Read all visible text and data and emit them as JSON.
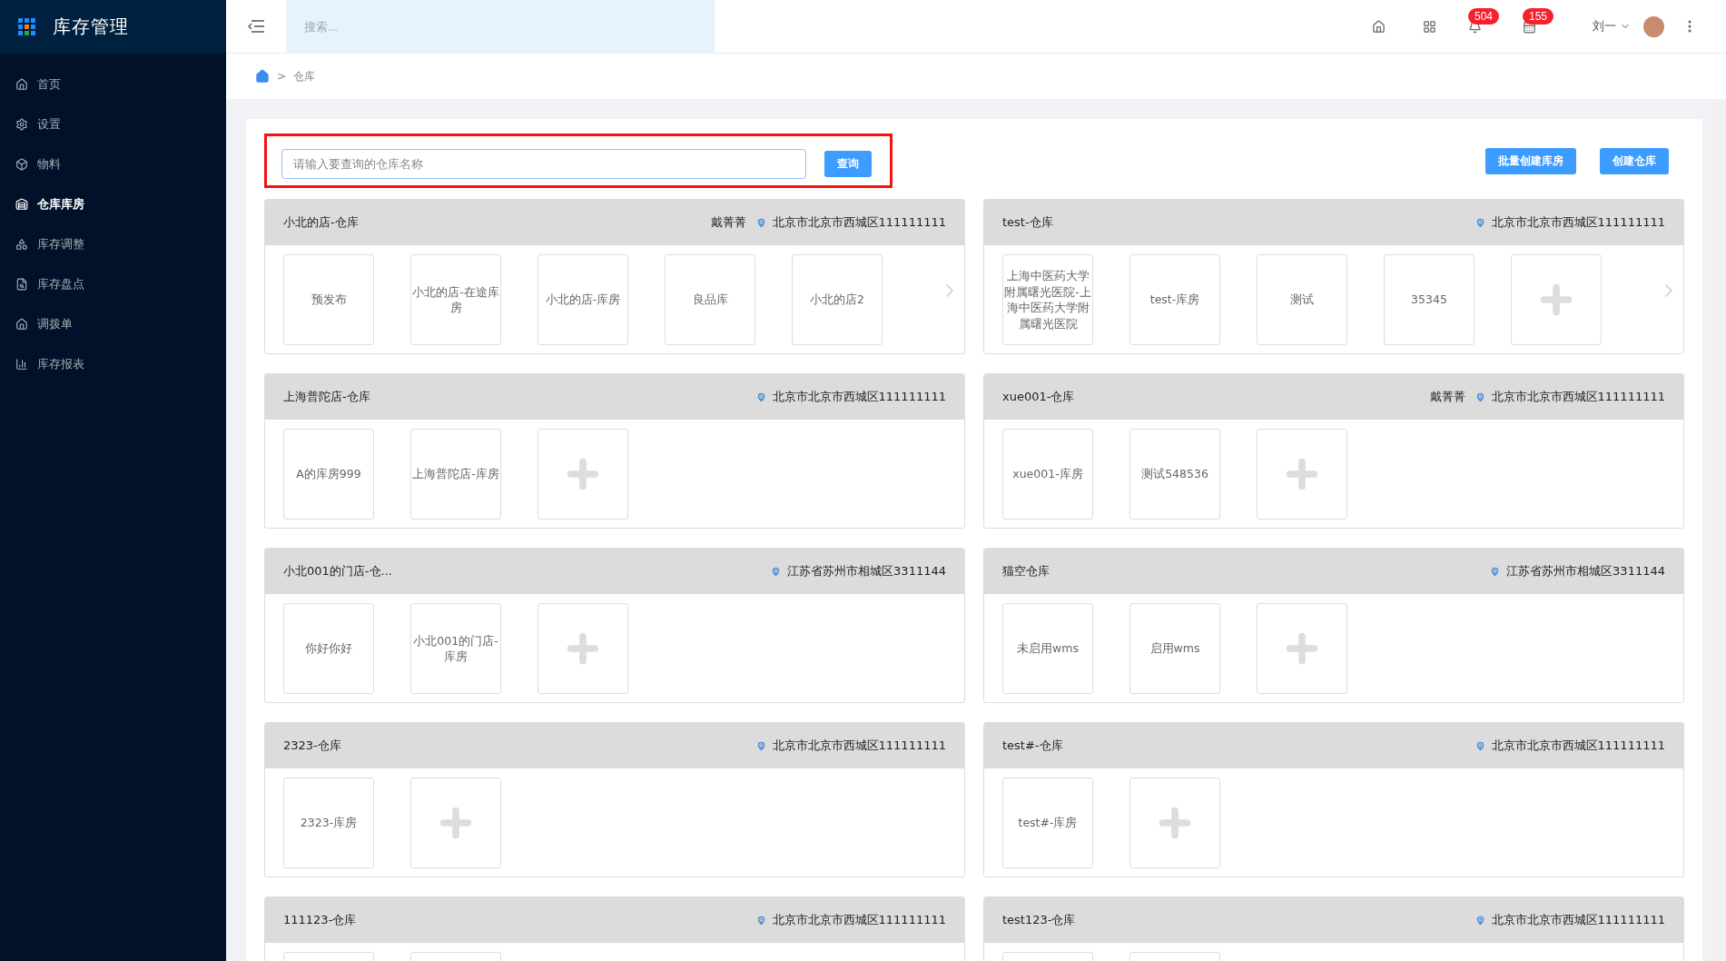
{
  "app": {
    "title": "库存管理"
  },
  "sidebar": {
    "items": [
      {
        "label": "首页",
        "selected": false
      },
      {
        "label": "设置",
        "selected": false
      },
      {
        "label": "物料",
        "selected": false
      },
      {
        "label": "仓库库房",
        "selected": true
      },
      {
        "label": "库存调整",
        "selected": false
      },
      {
        "label": "库存盘点",
        "selected": false
      },
      {
        "label": "调拨单",
        "selected": false
      },
      {
        "label": "库存报表",
        "selected": false
      }
    ]
  },
  "topbar": {
    "search_placeholder": "搜索...",
    "badges": [
      "504",
      "155"
    ],
    "user": "刘一"
  },
  "breadcrumb": {
    "separator": ">",
    "items": [
      "仓库"
    ]
  },
  "search": {
    "placeholder": "请输入要查询的仓库名称",
    "button": "查询",
    "highlighted": true
  },
  "actions": [
    "批量创建库房",
    "创建仓库"
  ],
  "warehouses": [
    {
      "name": "小北的店-仓库",
      "manager": "戴菁菁",
      "address": "北京市北京市西城区111111111",
      "has_more": true,
      "tiles": [
        {
          "kind": "room",
          "label": "预发布"
        },
        {
          "kind": "room",
          "label": "小北的店-在途库房"
        },
        {
          "kind": "room",
          "label": "小北的店-库房"
        },
        {
          "kind": "room",
          "label": "良品库"
        },
        {
          "kind": "room",
          "label": "小北的店2"
        }
      ]
    },
    {
      "name": "test-仓库",
      "address": "北京市北京市西城区111111111",
      "has_more": true,
      "tiles": [
        {
          "kind": "room",
          "label": "上海中医药大学附属曙光医院-上海中医药大学附属曙光医院"
        },
        {
          "kind": "room",
          "label": "test-库房"
        },
        {
          "kind": "room",
          "label": "测试"
        },
        {
          "kind": "room",
          "label": "35345"
        },
        {
          "kind": "add"
        }
      ]
    },
    {
      "name": "上海普陀店-仓库",
      "address": "北京市北京市西城区111111111",
      "has_more": false,
      "tiles": [
        {
          "kind": "room",
          "label": "A的库房999"
        },
        {
          "kind": "room",
          "label": "上海普陀店-库房"
        },
        {
          "kind": "add"
        }
      ]
    },
    {
      "name": "xue001-仓库",
      "manager": "戴菁菁",
      "address": "北京市北京市西城区111111111",
      "has_more": false,
      "tiles": [
        {
          "kind": "room",
          "label": "xue001-库房"
        },
        {
          "kind": "room",
          "label": "测试548536"
        },
        {
          "kind": "add"
        }
      ]
    },
    {
      "name": "小北001的门店-仓...",
      "address": "江苏省苏州市相城区3311144",
      "has_more": false,
      "tiles": [
        {
          "kind": "room",
          "label": "你好你好"
        },
        {
          "kind": "room",
          "label": "小北001的门店-库房"
        },
        {
          "kind": "add"
        }
      ]
    },
    {
      "name": "猫空仓库",
      "address": "江苏省苏州市相城区3311144",
      "has_more": false,
      "tiles": [
        {
          "kind": "room",
          "label": "未启用wms"
        },
        {
          "kind": "room",
          "label": "启用wms"
        },
        {
          "kind": "add"
        }
      ]
    },
    {
      "name": "2323-仓库",
      "address": "北京市北京市西城区111111111",
      "has_more": false,
      "tiles": [
        {
          "kind": "room",
          "label": "2323-库房"
        },
        {
          "kind": "add"
        }
      ]
    },
    {
      "name": "test#-仓库",
      "address": "北京市北京市西城区111111111",
      "has_more": false,
      "tiles": [
        {
          "kind": "room",
          "label": "test#-库房"
        },
        {
          "kind": "add"
        }
      ]
    },
    {
      "name": "111123-仓库",
      "address": "北京市北京市西城区111111111",
      "has_more": false,
      "tiles": [
        {
          "kind": "cut"
        },
        {
          "kind": "cut"
        }
      ]
    },
    {
      "name": "test123-仓库",
      "address": "北京市北京市西城区111111111",
      "has_more": false,
      "tiles": [
        {
          "kind": "cut"
        },
        {
          "kind": "cut"
        }
      ]
    }
  ]
}
